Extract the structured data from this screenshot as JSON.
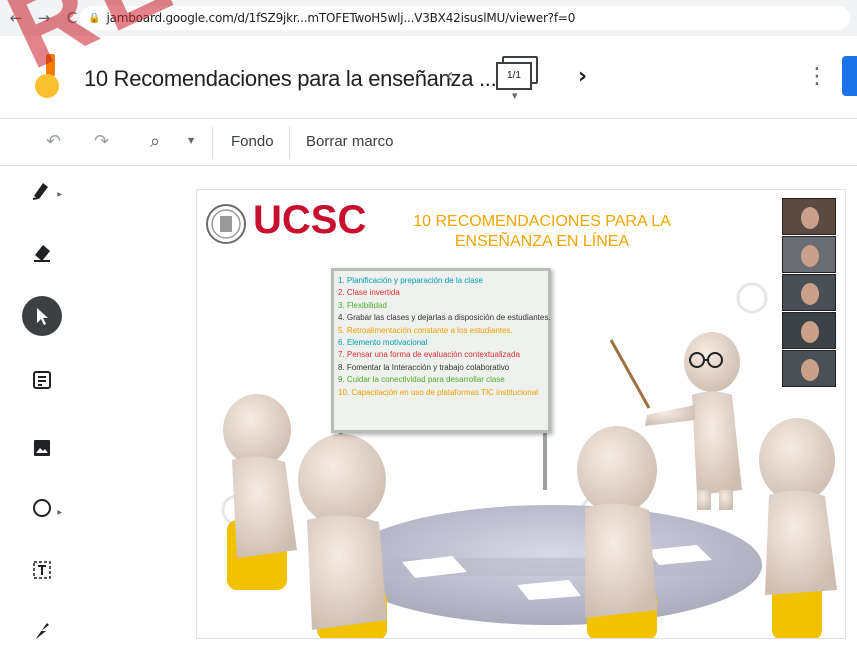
{
  "browser": {
    "back": "←",
    "forward": "→",
    "reload": "C",
    "url": "jamboard.google.com/d/1fSZ9jkr...mTOFETwoH5wlj...V3BX42isuslMU/viewer?f=0"
  },
  "header": {
    "title": "10 Recomendaciones para la enseñanza ...",
    "frame_counter": "1/1",
    "prev": "‹",
    "next": "›",
    "more": "⋮"
  },
  "toolbar": {
    "undo": "↶",
    "redo": "↷",
    "zoom": "⌕",
    "background_label": "Fondo",
    "clear_label": "Borrar marco"
  },
  "slide": {
    "logo_text": "UCSC",
    "title_line1": "10 RECOMENDACIONES PARA LA",
    "title_line2": "ENSEÑANZA EN LÍNEA",
    "recommendations": [
      {
        "text": "1. Planificación y preparación de la clase",
        "color": "#00a0b0"
      },
      {
        "text": "2. Clase invertida",
        "color": "#e03030"
      },
      {
        "text": "3. Flexibilidad",
        "color": "#4caf2a"
      },
      {
        "text": "4. Grabar las clases y dejarlas a disposición de estudiantes.",
        "color": "#333333"
      },
      {
        "text": "5. Retroalimentación constante a los estudiantes.",
        "color": "#f0a000"
      },
      {
        "text": "6. Elemento motivacional",
        "color": "#00a0b0"
      },
      {
        "text": "7. Pensar una forma de evaluación contextualizada",
        "color": "#e03030"
      },
      {
        "text": "8. Fomentar la Interacción y trabajo colaborativo",
        "color": "#333333"
      },
      {
        "text": "9. Cuidar la conectividad  para desarrollar clase",
        "color": "#4caf2a"
      },
      {
        "text": "10. Capacitación en uso de plataformas TIC institucional",
        "color": "#f0a000"
      }
    ],
    "participant_count": 5
  },
  "overlay": {
    "watermark": "RESET"
  },
  "colors": {
    "accent": "#1a73e8",
    "logo_orange": "#f57c00",
    "logo_yellow": "#fbc02d",
    "ucsc_red": "#c8102e",
    "title_gold": "#f0a500"
  }
}
